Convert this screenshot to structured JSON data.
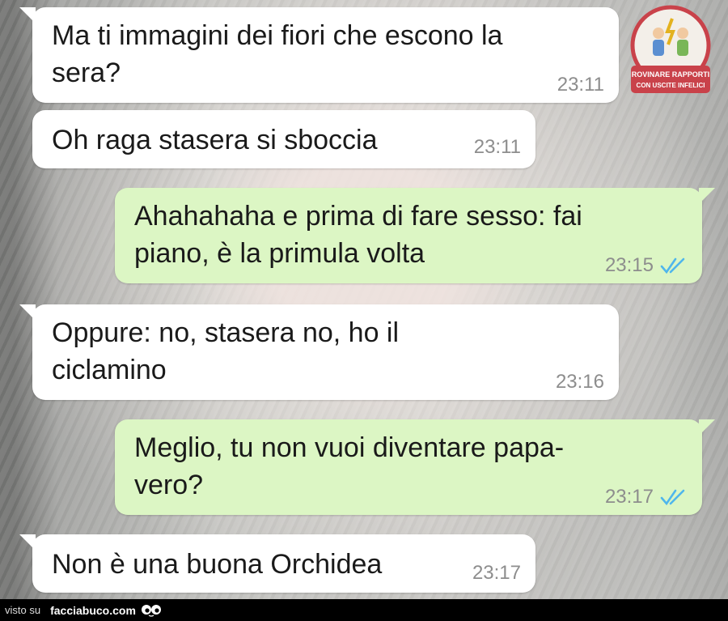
{
  "messages": [
    {
      "text": "Ma ti immagini dei fiori che escono la\nsera?",
      "time": "23:11",
      "direction": "incoming"
    },
    {
      "text": "Oh raga stasera si sboccia",
      "time": "23:11",
      "direction": "incoming"
    },
    {
      "text": "Ahahahaha e prima di fare sesso: fai\npiano, è la primula volta",
      "time": "23:15",
      "direction": "outgoing",
      "status": "read"
    },
    {
      "text": "Oppure: no, stasera no, ho il\nciclamino",
      "time": "23:16",
      "direction": "incoming"
    },
    {
      "text": "Meglio, tu non vuoi diventare papa-\nvero?",
      "time": "23:17",
      "direction": "outgoing",
      "status": "read"
    },
    {
      "text": "Non è una buona Orchidea",
      "time": "23:17",
      "direction": "incoming"
    }
  ],
  "watermark": {
    "line1": "ROVINARE RAPPORTI",
    "line2": "CON USCITE INFELICI"
  },
  "footer": {
    "visto_su": "visto su",
    "site": "facciabuco.com"
  },
  "colors": {
    "incoming": "#ffffff",
    "outgoing": "#dcf6c4",
    "read_ticks": "#4fb6ec"
  },
  "icons": {
    "read": "double-check-icon",
    "footer": "eyes-icon"
  }
}
